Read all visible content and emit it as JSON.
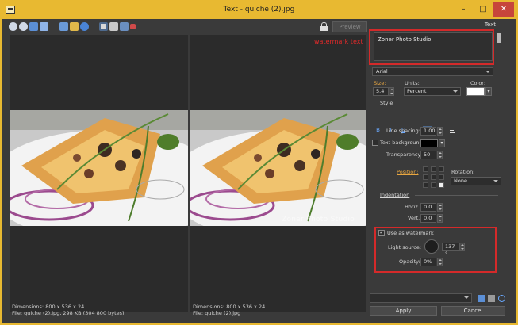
{
  "window": {
    "title": "Text - quiche (2).jpg",
    "minimize_glyph": "–",
    "maximize_glyph": "□",
    "close_glyph": "✕"
  },
  "toolbar": {
    "preview_label": "Preview",
    "icons": [
      "zoom-in-icon",
      "zoom-out-icon",
      "zoom-100-icon",
      "fit-window-icon",
      "image-icon",
      "folder-icon",
      "info-icon",
      "split-vertical-icon",
      "split-horizontal-icon",
      "single-view-icon",
      "stop-icon",
      "lock-icon"
    ]
  },
  "preview": {
    "watermark_label": "watermark text",
    "watermark_overlay": "Zoner Photo Studio",
    "left_status": [
      "Dimensions: 800 x 536 x 24",
      "File: quiche (2).jpg, 298 KB (304 800 bytes)"
    ],
    "right_status": [
      "Dimensions: 800 x 536 x 24",
      "File: quiche (2).jpg"
    ]
  },
  "panel": {
    "header": "Text",
    "text_value": "Zoner Photo Studio",
    "font": "Arial",
    "size_label": "Size:",
    "size_value": "5.4",
    "units_label": "Units:",
    "units_value": "Percent",
    "color_label": "Color:",
    "color_value": "#ffffff",
    "style_label": "Style",
    "style_buttons": [
      "B",
      "I",
      "U"
    ],
    "line_spacing_label": "Line spacing:",
    "line_spacing_value": "1.00",
    "text_background_label": "Text background:",
    "text_background_color": "#000000",
    "transparency_label": "Transparency:",
    "transparency_value": "50",
    "position_label": "Position:",
    "rotation_label": "Rotation:",
    "rotation_value": "None",
    "indentation_label": "Indentation",
    "horiz_label": "Horiz.:",
    "horiz_value": "0.0",
    "vert_label": "Vert.:",
    "vert_value": "0.0",
    "use_watermark_label": "Use as watermark",
    "use_watermark_checked": "✓",
    "light_source_label": "Light source:",
    "light_source_value": "137 °",
    "opacity_label": "Opacity:",
    "opacity_value": "0%",
    "apply_label": "Apply",
    "cancel_label": "Cancel"
  },
  "colors": {
    "accent_red": "#d42a2a",
    "title_bar": "#e8b931",
    "label_orange": "#e8a640"
  }
}
